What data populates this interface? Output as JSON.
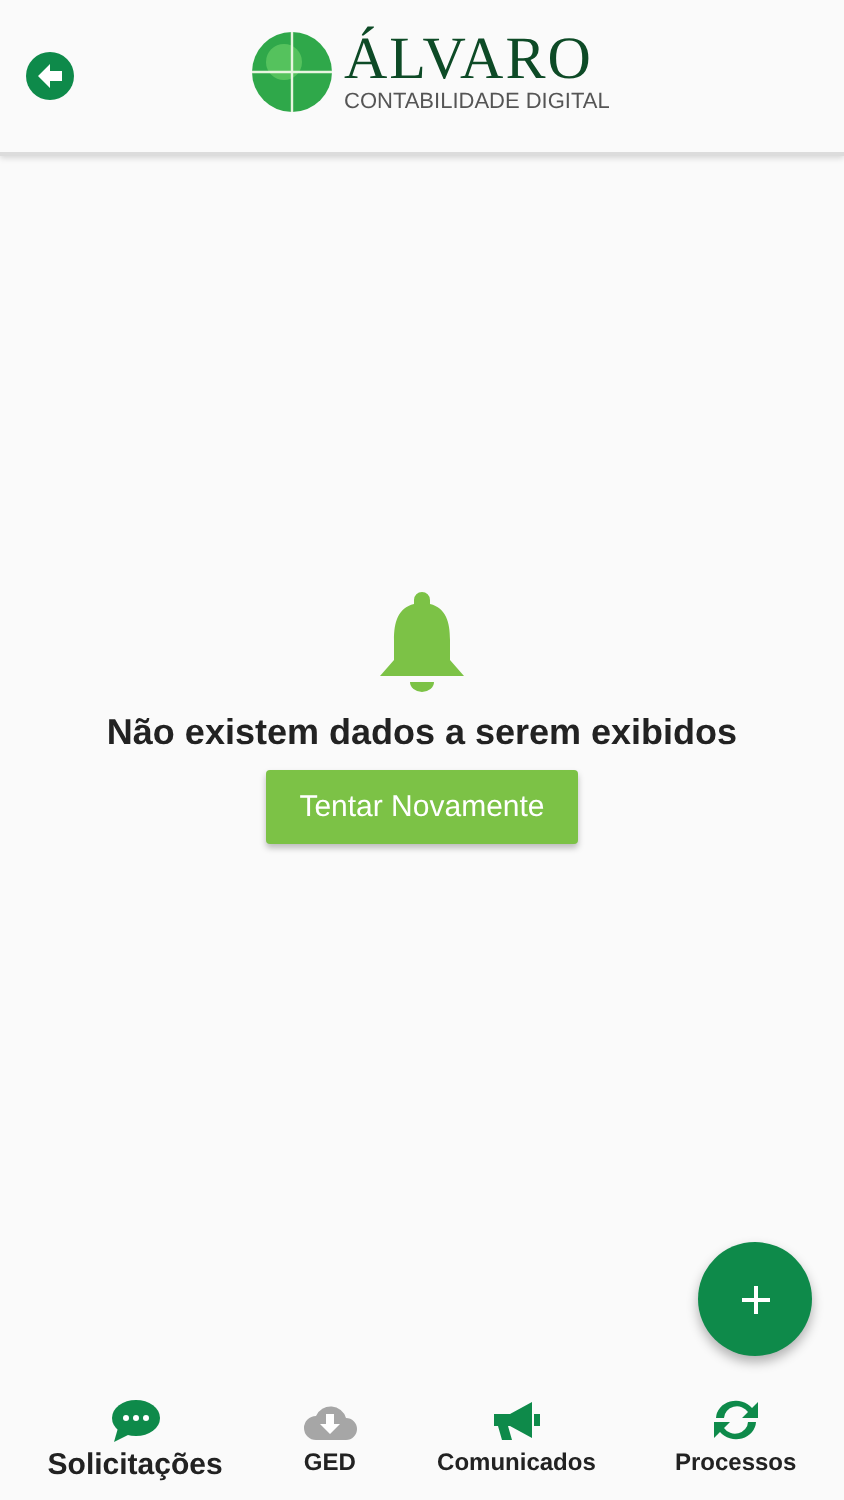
{
  "header": {
    "logo_title": "ÁLVARO",
    "logo_subtitle": "CONTABILIDADE DIGITAL"
  },
  "empty_state": {
    "message": "Não existem dados a serem exibidos",
    "retry_button": "Tentar Novamente"
  },
  "tabs": [
    {
      "label": "Solicitações",
      "kind": "chat",
      "selected": true,
      "disabled": false
    },
    {
      "label": "GED",
      "kind": "cloud",
      "selected": false,
      "disabled": true
    },
    {
      "label": "Comunicados",
      "kind": "megaphone",
      "selected": false,
      "disabled": false
    },
    {
      "label": "Processos",
      "kind": "sync",
      "selected": false,
      "disabled": false
    }
  ]
}
